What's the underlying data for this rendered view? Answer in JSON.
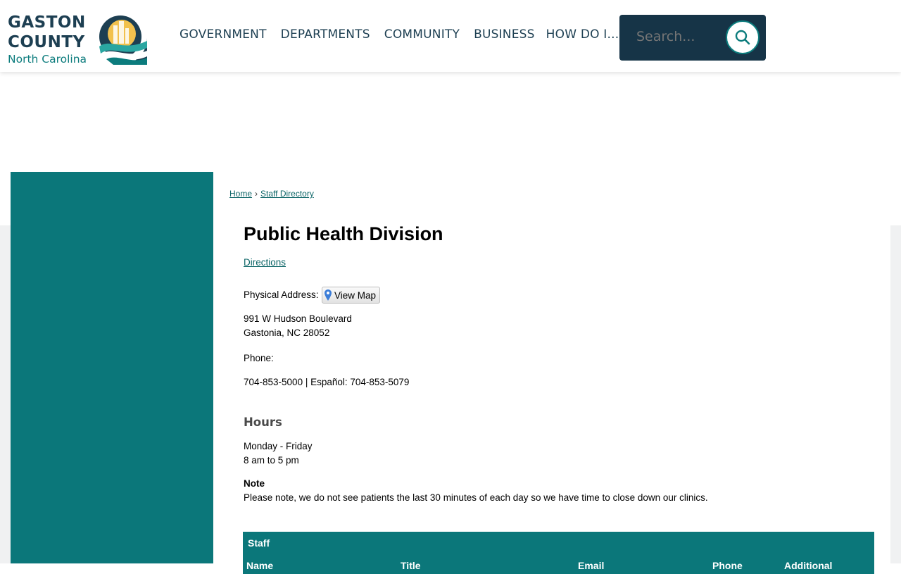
{
  "logo": {
    "line1": "GASTON",
    "line2": "COUNTY",
    "line3": "North Carolina"
  },
  "nav": {
    "items": [
      "GOVERNMENT",
      "DEPARTMENTS",
      "COMMUNITY",
      "BUSINESS",
      "HOW DO I..."
    ]
  },
  "search": {
    "placeholder": "Search...",
    "icon": "search-icon"
  },
  "breadcrumb": {
    "home": "Home",
    "separator": "›",
    "current": "Staff Directory"
  },
  "page": {
    "title": "Public Health Division",
    "directions": "Directions",
    "address_label": "Physical Address:",
    "view_map": "View Map",
    "address_line1": "991 W Hudson Boulevard",
    "address_line2": "Gastonia, NC 28052",
    "phone_label": "Phone:",
    "phone": "704-853-5000 | Español: 704-853-5079",
    "hours_heading": "Hours",
    "hours_days": "Monday - Friday",
    "hours_time": "8 am to 5 pm",
    "note_label": "Note",
    "note_text": "Please note, we do not see patients the last 30 minutes of each day so we have time to close down our clinics."
  },
  "staff": {
    "title": "Staff",
    "columns": [
      "Name",
      "Title",
      "Email",
      "Phone",
      "Additional"
    ]
  },
  "colors": {
    "teal": "#0b777a",
    "navy": "#163447",
    "logo_gold": "#f2c14e"
  }
}
